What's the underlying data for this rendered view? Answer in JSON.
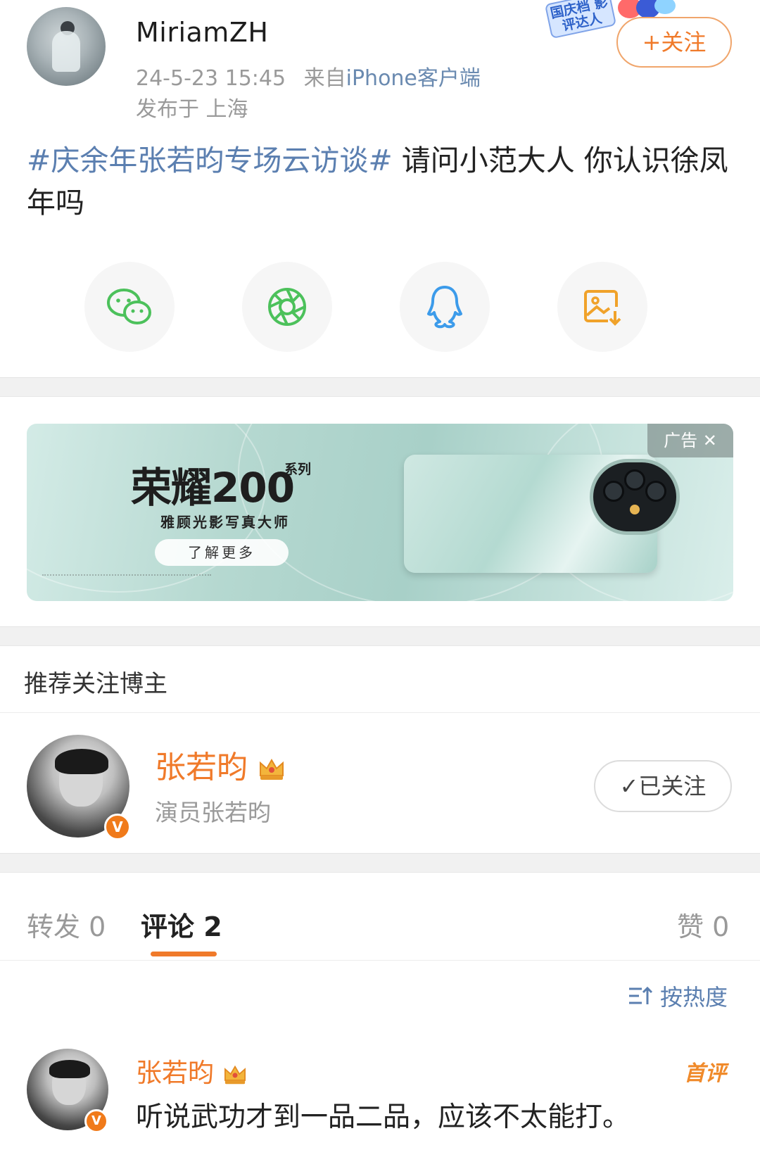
{
  "post": {
    "username": "MiriamZH",
    "date": "24-5-23 15:45",
    "source_prefix": "来自",
    "source_client": "iPhone客户端",
    "location": "发布于 上海",
    "follow_label": "+关注",
    "sticker_text": "国庆档 影评达人",
    "topic": "#庆余年张若昀专场云访谈#",
    "body": " 请问小范大人 你认识徐凤年吗"
  },
  "share": {
    "items": [
      {
        "name": "wechat",
        "color": "#4cc15b"
      },
      {
        "name": "moments",
        "color": "#4cc15b"
      },
      {
        "name": "qq",
        "color": "#3c9bea"
      },
      {
        "name": "save-image",
        "color": "#f0a22a"
      }
    ]
  },
  "ad": {
    "brand": "荣耀200",
    "series": "系列",
    "tagline": "雅顾光影写真大师",
    "cta": "了解更多",
    "label": "广告 ✕"
  },
  "recommend": {
    "title": "推荐关注博主",
    "name": "张若昀",
    "desc": "演员张若昀",
    "verified": "V",
    "followed_label": "✓已关注"
  },
  "tabs": {
    "repost": "转发 0",
    "comment": "评论 2",
    "like": "赞 0"
  },
  "sort": {
    "label": "按热度"
  },
  "comment": {
    "name": "张若昀",
    "badge": "首评",
    "verified": "V",
    "text": "听说武功才到一品二品，应该不太能打。"
  },
  "colors": {
    "accent_orange": "#f07a2a",
    "topic_blue": "#5b7fb0"
  }
}
